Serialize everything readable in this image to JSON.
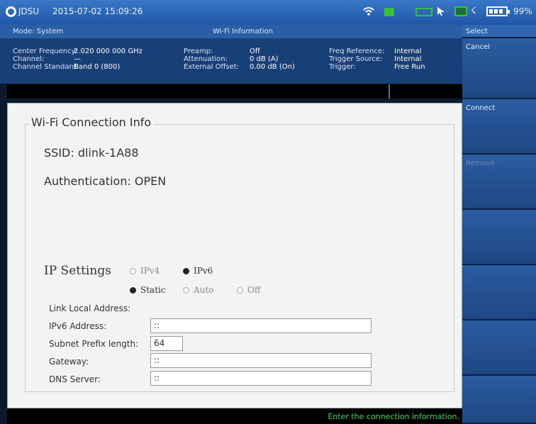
{
  "status_bar": {
    "brand": "JDSU",
    "datetime": "2015-07-02 15:09:26",
    "battery_percent": "99%"
  },
  "mode_row": {
    "mode": "Mode: System",
    "title": "Wi-Fi Information"
  },
  "info": {
    "col1": [
      "Center Frequency:",
      "Channel:",
      "Channel Standard:"
    ],
    "col2": [
      "2.020 000 000 GHz",
      "—",
      "Band 0 (800)"
    ],
    "col3": [
      "Preamp:",
      "Attenuation:",
      "External Offset:"
    ],
    "col4": [
      "Off",
      "0 dB (A)",
      "0.00 dB (On)"
    ],
    "col5": [
      "Freq Reference:",
      "Trigger Source:",
      "Trigger:"
    ],
    "col6": [
      "Internal",
      "Internal",
      "Free Run"
    ]
  },
  "main": {
    "section_title": "Wi-Fi Connection Info",
    "ssid": "SSID: dlink-1A88",
    "authentication": "Authentication: OPEN",
    "ip_settings_label": "IP Settings",
    "ip_version_options": [
      {
        "label": "IPv4",
        "selected": false
      },
      {
        "label": "IPv6",
        "selected": true
      }
    ],
    "mode_options": [
      {
        "label": "Static",
        "selected": true
      },
      {
        "label": "Auto",
        "selected": false
      },
      {
        "label": "Off",
        "selected": false
      }
    ],
    "link_local_label": "Link Local Address:",
    "ipv6_label": "IPv6 Address:",
    "ipv6_value": "::",
    "prefix_label": "Subnet Prefix length:",
    "prefix_value": "64",
    "gateway_label": "Gateway:",
    "gateway_value": "::",
    "dns_label": "DNS Server:",
    "dns_value": "::"
  },
  "bottom_message": "Enter the connection information.",
  "softkeys": {
    "header": "Select",
    "cancel": "Cancel",
    "connect": "Connect",
    "remove": "Remove"
  },
  "colors": {
    "accent_blue": "#2a5fa8",
    "status_green": "#34d34a"
  }
}
